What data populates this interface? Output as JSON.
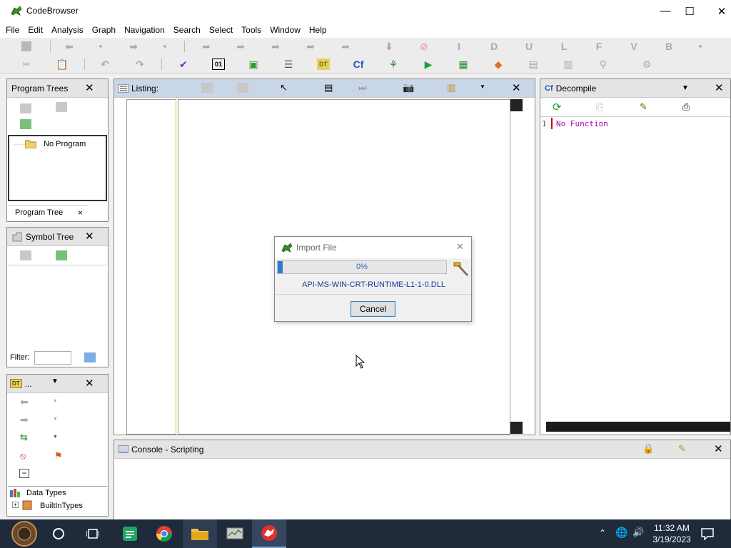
{
  "window": {
    "title": "CodeBrowser",
    "minimize": "—",
    "maximize": "☐",
    "close": "✕"
  },
  "menu": [
    "File",
    "Edit",
    "Analysis",
    "Graph",
    "Navigation",
    "Search",
    "Select",
    "Tools",
    "Window",
    "Help"
  ],
  "toolbar": {
    "letters": [
      "I",
      "D",
      "U",
      "L",
      "F",
      "V",
      "B"
    ]
  },
  "program_trees": {
    "title": "Program Trees",
    "item": "No Program",
    "tab": "Program Tree",
    "tab_close": "×"
  },
  "symbol_tree": {
    "title": "Symbol Tree",
    "filter_label": "Filter:",
    "filter_value": ""
  },
  "data_types": {
    "title": "...",
    "root": "Data Types",
    "child": "BuiltInTypes"
  },
  "listing": {
    "title": "Listing:"
  },
  "decompile": {
    "title": "Decompile",
    "line_number": "1",
    "text": "No Function"
  },
  "console": {
    "title": "Console - Scripting"
  },
  "dialog": {
    "title": "Import File",
    "progress_text": "0%",
    "progress_value": 0.03,
    "file": "API-MS-WIN-CRT-RUNTIME-L1-1-0.DLL",
    "cancel": "Cancel"
  },
  "taskbar": {
    "time": "11:32 AM",
    "date": "3/19/2023"
  },
  "colors": {
    "accent_blue": "#2c7bd0",
    "decompile_text": "#b000b0",
    "taskbar": "#1f2a3a"
  }
}
